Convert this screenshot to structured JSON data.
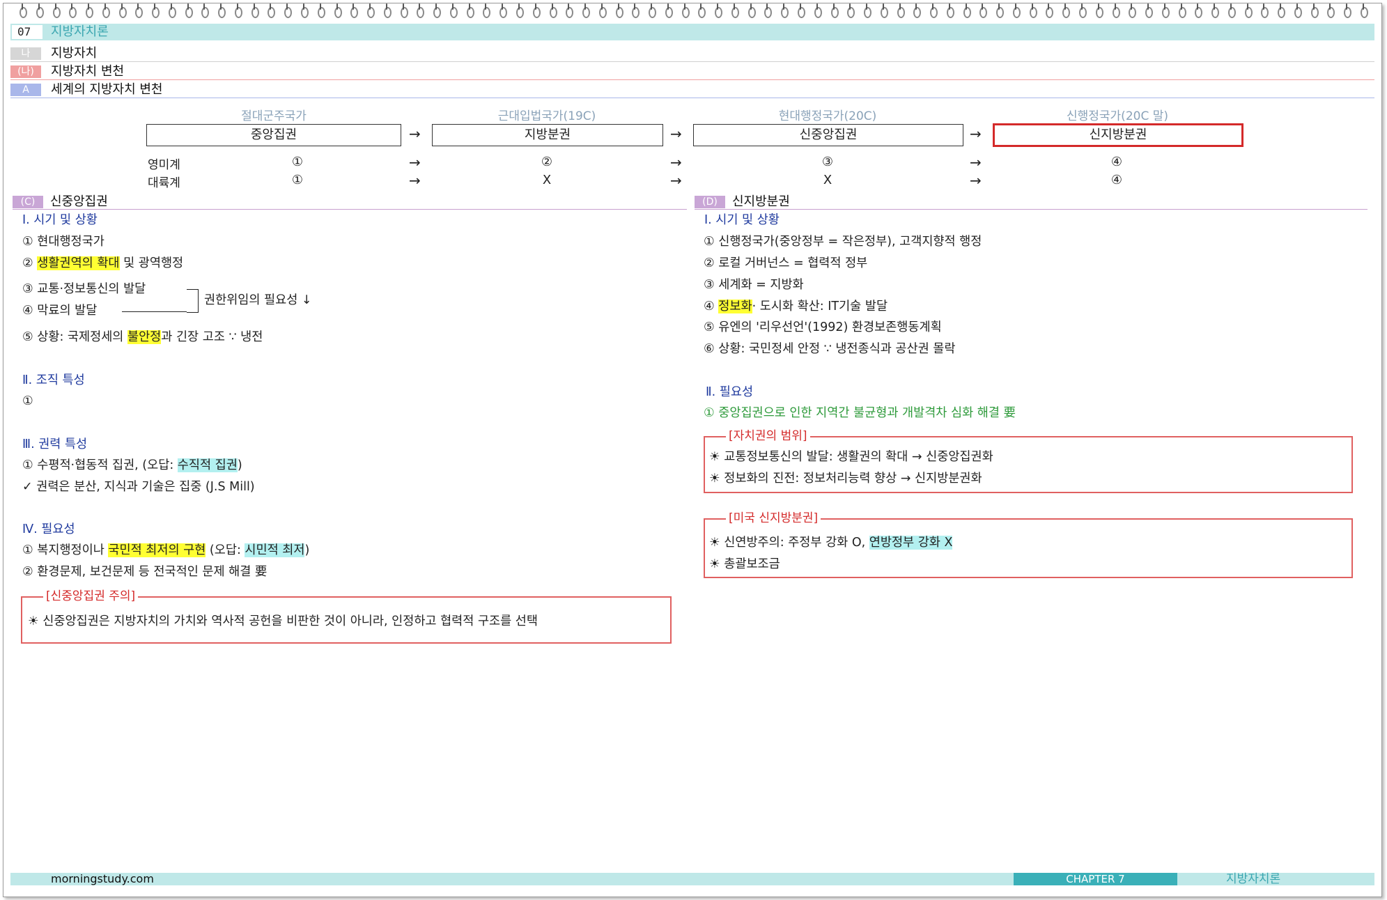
{
  "header": {
    "chapter_num": "07",
    "title": "지방자치론"
  },
  "headings": [
    {
      "tag": "나",
      "text": "지방자치",
      "color": "#d6d6d6"
    },
    {
      "tag": "(나)",
      "text": "지방자치 변천",
      "color": "#f0a0a0"
    },
    {
      "tag": "A",
      "text": "세계의 지방자치 변천",
      "color": "#a9b7ea"
    }
  ],
  "timeline": {
    "stages": [
      "절대군주국가",
      "근대입법국가(19C)",
      "현대행정국가(20C)",
      "신행정국가(20C 말)"
    ],
    "boxes": [
      "중앙집권",
      "지방분권",
      "신중앙집권",
      "신지방분권"
    ],
    "arrow": "→",
    "rows": [
      {
        "label": "영미계",
        "values": [
          "①",
          "②",
          "③",
          "④"
        ]
      },
      {
        "label": "대륙계",
        "values": [
          "①",
          "X",
          "X",
          "④"
        ]
      }
    ]
  },
  "left": {
    "tag": "(C)",
    "title": "신중앙집권",
    "s1": {
      "title": "Ⅰ. 시기 및 상황",
      "i1": "① 현대행정국가",
      "i2_pre": "② ",
      "i2_hl": "생활권역의 확대",
      "i2_post": " 및 광역행정",
      "i3": "③ 교통·정보통신의 발달",
      "i4": "④ 막료의 발달",
      "bracket_note": "권한위임의 필요성 ↓",
      "i5_pre": "⑤ 상황: 국제정세의 ",
      "i5_hl": "불안정",
      "i5_post": "과 긴장 고조 ∵ 냉전"
    },
    "s2": {
      "title": "Ⅱ. 조직 특성",
      "i1": "①"
    },
    "s3": {
      "title": "Ⅲ. 권력 특성",
      "i1_pre": "① 수평적·협동적 집권, (오답: ",
      "i1_hl": "수직적 집권",
      "i1_post": ")",
      "i2": "✓ 권력은 분산, 지식과 기술은 집중 (J.S Mill)"
    },
    "s4": {
      "title": "Ⅳ. 필요성",
      "i1_pre": "① 복지행정이나 ",
      "i1_hl": "국민적 최저의 구현",
      "i1_mid": " (오답: ",
      "i1_hl2": "시민적 최저",
      "i1_post": ")",
      "i2": "② 환경문제, 보건문제 등 전국적인 문제 해결 要"
    },
    "note": {
      "caption": "[신중앙집권 주의]",
      "text": "☀ 신중앙집권은 지방자치의 가치와 역사적 공헌을 비판한 것이 아니라, 인정하고 협력적 구조를 선택"
    }
  },
  "right": {
    "tag": "(D)",
    "title": "신지방분권",
    "s1": {
      "title": "Ⅰ. 시기 및 상황",
      "i1": "① 신행정국가(중앙정부 = 작은정부), 고객지향적 행정",
      "i2": "② 로컬 거버넌스 = 협력적 정부",
      "i3": "③ 세계화 = 지방화",
      "i4_pre": "④ ",
      "i4_hl": "정보화",
      "i4_post": "· 도시화 확산: IT기술 발달",
      "i5": "⑤ 유엔의 '리우선언'(1992) 환경보존행동계획",
      "i6": "⑥ 상황: 국민정세 안정 ∵ 냉전종식과 공산권 몰락"
    },
    "s2": {
      "title": "Ⅱ. 필요성",
      "i1": "① 중앙집권으로 인한 지역간 불균형과 개발격차 심화 해결 要"
    },
    "box1": {
      "caption": "[자치권의 범위]",
      "l1": "☀ 교통정보통신의 발달: 생활권의 확대 → 신중앙집권화",
      "l2": "☀ 정보화의 진전: 정보처리능력 향상 → 신지방분권화"
    },
    "box2": {
      "caption": "[미국 신지방분권]",
      "l1_pre": "☀ 신연방주의: 주정부 강화 O, ",
      "l1_hl": "연방정부 강화 X",
      "l2": "☀ 총괄보조금"
    }
  },
  "footer": {
    "site": "morningstudy.com",
    "chapter": "CHAPTER 7",
    "subject": "지방자치론"
  },
  "colors": {
    "teal": "#bfe8e8",
    "accent": "#3ab0b8",
    "red": "#d42a2a",
    "highlight_yellow": "#ffff33",
    "highlight_cyan": "#b3f0f0"
  }
}
